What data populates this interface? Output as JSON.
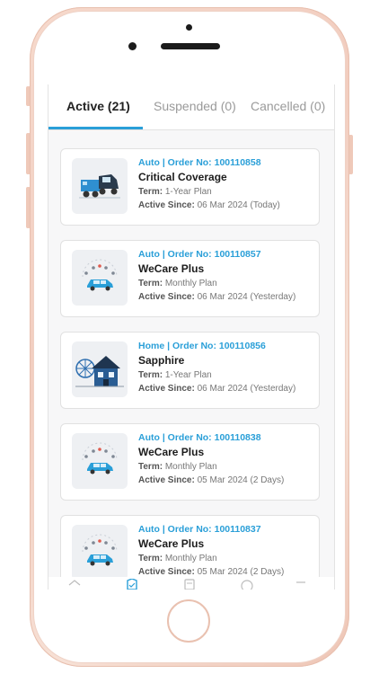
{
  "tabs": [
    {
      "label": "Active (21)",
      "active": true
    },
    {
      "label": "Suspended (0)",
      "active": false
    },
    {
      "label": "Cancelled (0)",
      "active": false
    }
  ],
  "accent_color": "#2a9fd8",
  "orders": [
    {
      "meta": "Auto | Order No: 100110858",
      "title": "Critical Coverage",
      "term_label": "Term:",
      "term": "1-Year Plan",
      "since_label": "Active Since:",
      "since": "06 Mar 2024 (Today)",
      "icon": "car-tow-truck-icon"
    },
    {
      "meta": "Auto | Order No: 100110857",
      "title": "WeCare Plus",
      "term_label": "Term:",
      "term": "Monthly Plan",
      "since_label": "Active Since:",
      "since": "06 Mar 2024 (Yesterday)",
      "icon": "car-services-icon"
    },
    {
      "meta": "Home | Order No: 100110856",
      "title": "Sapphire",
      "term_label": "Term:",
      "term": "1-Year Plan",
      "since_label": "Active Since:",
      "since": "06 Mar 2024 (Yesterday)",
      "icon": "house-icon"
    },
    {
      "meta": "Auto | Order No: 100110838",
      "title": "WeCare Plus",
      "term_label": "Term:",
      "term": "Monthly Plan",
      "since_label": "Active Since:",
      "since": "05 Mar 2024 (2 Days)",
      "icon": "car-services-icon"
    },
    {
      "meta": "Auto | Order No: 100110837",
      "title": "WeCare Plus",
      "term_label": "Term:",
      "term": "Monthly Plan",
      "since_label": "Active Since:",
      "since": "05 Mar 2024 (2 Days)",
      "icon": "car-services-icon"
    }
  ],
  "nav": [
    "home-icon",
    "shield-icon",
    "document-icon",
    "help-icon",
    "menu-icon"
  ]
}
